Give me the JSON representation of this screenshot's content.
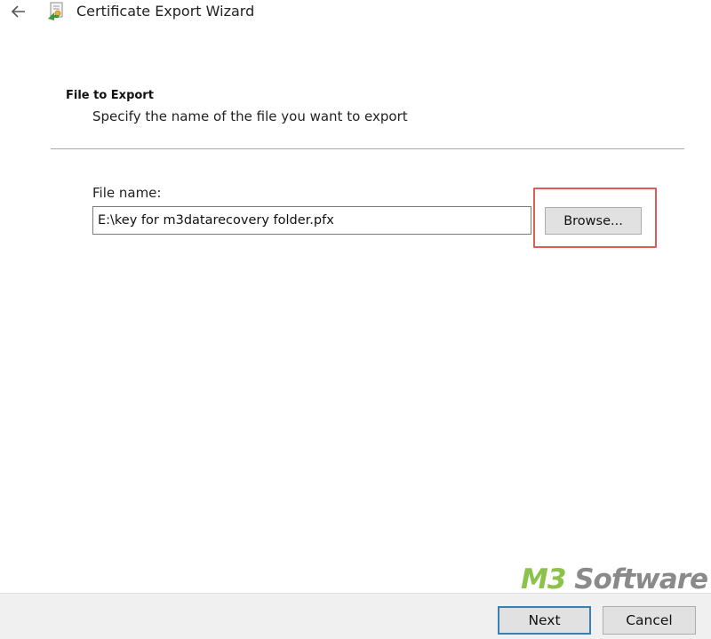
{
  "window": {
    "title": "Certificate Export Wizard",
    "back_icon": "back-arrow-icon",
    "app_icon": "certificate-wizard-icon"
  },
  "header": {
    "title": "File to Export",
    "subtitle": "Specify the name of the file you want to export"
  },
  "form": {
    "file_name_label": "File name:",
    "file_name_value": "E:\\key for m3datarecovery folder.pfx",
    "browse_label": "Browse..."
  },
  "footer": {
    "next_label": "Next",
    "cancel_label": "Cancel"
  },
  "watermark": {
    "brand_part1": "M3",
    "brand_part2": " Software"
  },
  "colors": {
    "highlight_border": "#e05a5a",
    "default_button_border": "#3c7fb1",
    "watermark_green": "#8bc34a",
    "watermark_gray": "#8a8a8a"
  }
}
